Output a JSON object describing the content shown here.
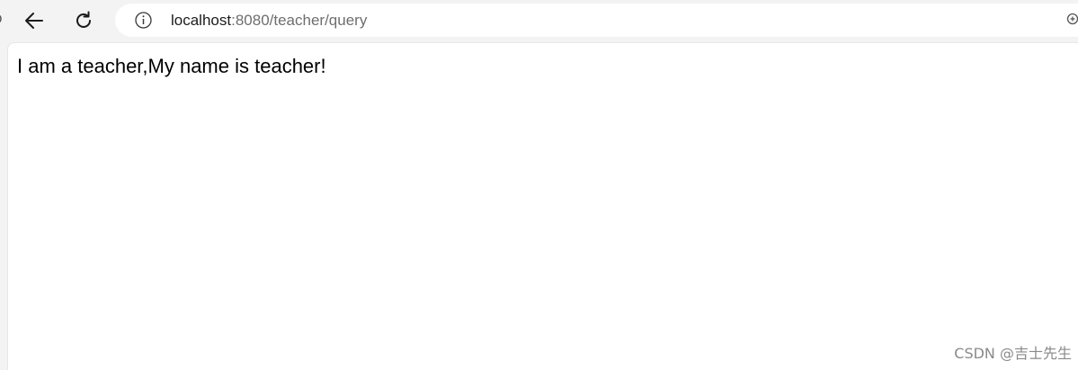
{
  "browser": {
    "address": {
      "host": "localhost",
      "rest": ":8080/teacher/query"
    },
    "icons": {
      "back": "arrow-left-icon",
      "refresh": "refresh-icon",
      "info": "info-icon",
      "zoom": "zoom-icon"
    }
  },
  "page": {
    "body_text": "I am a teacher,My name is teacher!"
  },
  "watermark": {
    "text": "CSDN @吉士先生"
  }
}
